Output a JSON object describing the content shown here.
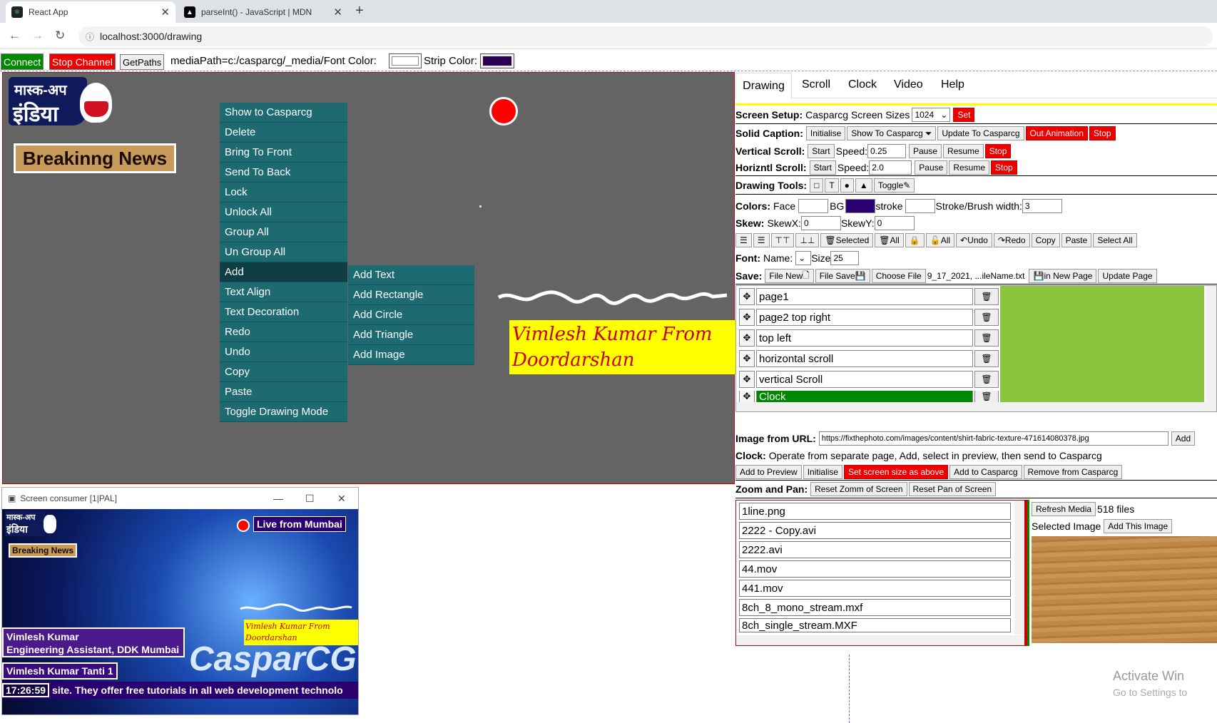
{
  "browser": {
    "tabs": [
      {
        "title": "React App",
        "icon": "react-icon"
      },
      {
        "title": "parseInt() - JavaScript | MDN",
        "icon": "mdn-icon"
      }
    ],
    "url": "localhost:3000/drawing"
  },
  "topbar": {
    "connect": "Connect",
    "stop_channel": "Stop Channel",
    "get_paths": "GetPaths",
    "media_path": "mediaPath=c:/casparcg/_media/Font Color:",
    "strip_color_label": "Strip Color:",
    "font_color": "#ffffff",
    "strip_color": "#2a0050"
  },
  "canvas": {
    "logo_line1": "मास्क-अप",
    "logo_line2": "इंडिया",
    "breaking": "Breakinng News",
    "caption": "Vimlesh Kumar From Doordarshan",
    "context_menu": [
      "Show to Casparcg",
      "Delete",
      "Bring To Front",
      "Send To Back",
      "Lock",
      "Unlock All",
      "Group All",
      "Un Group All",
      "Add",
      "Text Align",
      "Text Decoration",
      "Redo",
      "Undo",
      "Copy",
      "Paste",
      "Toggle Drawing Mode"
    ],
    "submenu": [
      "Add Text",
      "Add Rectangle",
      "Add Circle",
      "Add Triangle",
      "Add Image"
    ]
  },
  "panel": {
    "tabs": [
      "Drawing",
      "Scroll",
      "Clock",
      "Video",
      "Help"
    ],
    "screen_setup": {
      "label": "Screen Setup:",
      "text": "Casparcg Screen Sizes",
      "value": "1024",
      "set": "Set"
    },
    "solid_caption": {
      "label": "Solid Caption:",
      "initialise": "Initialise",
      "show": "Show To Casparcg",
      "update": "Update To Casparcg",
      "out": "Out Animation",
      "stop": "Stop"
    },
    "vscroll": {
      "label": "Vertical Scroll:",
      "start": "Start",
      "speed_label": "Speed:",
      "speed": "0.25",
      "pause": "Pause",
      "resume": "Resume",
      "stop": "Stop"
    },
    "hscroll": {
      "label": "Horizntl Scroll:",
      "start": "Start",
      "speed_label": "Speed:",
      "speed": "2.0",
      "pause": "Pause",
      "resume": "Resume",
      "stop": "Stop"
    },
    "drawing_tools": {
      "label": "Drawing Tools:",
      "t": "T",
      "toggle": "Toggle"
    },
    "colors": {
      "label": "Colors:",
      "face": "Face",
      "bg": "BG",
      "stroke": "stroke",
      "width_label": "Stroke/Brush width:",
      "width": "3",
      "bg_color": "#2a0070"
    },
    "skew": {
      "label": "Skew:",
      "x_label": "SkewX:",
      "x": "0",
      "y_label": "SkewY:",
      "y": "0"
    },
    "align_row": {
      "selected": "Selected",
      "all": "All",
      "lock_all": "All",
      "undo": "Undo",
      "redo": "Redo",
      "copy": "Copy",
      "paste": "Paste",
      "select_all": "Select All"
    },
    "font": {
      "label": "Font:",
      "name_label": "Name:",
      "size_label": "Size",
      "size": "25"
    },
    "save": {
      "label": "Save:",
      "file_new": "File New",
      "file_save": "File Save",
      "choose": "Choose File",
      "filename": "9_17_2021, ...ileName.txt",
      "new_page": "in New Page",
      "update_page": "Update Page"
    },
    "layers": [
      "page1",
      "page2 top right",
      "top left",
      "horizontal scroll",
      "vertical Scroll",
      "Clock"
    ],
    "image_url": {
      "label": "Image from URL:",
      "value": "https://fixthephoto.com/images/content/shirt-fabric-texture-471614080378.jpg",
      "add": "Add"
    },
    "clock": {
      "label": "Clock:",
      "text": "Operate from separate page, Add, select in preview, then send to Casparcg",
      "add_preview": "Add to Preview",
      "initialise": "Initialise",
      "set_size": "Set screen size as above",
      "add_caspar": "Add to Casparcg",
      "remove": "Remove from Casparcg"
    },
    "zoom": {
      "label": "Zoom and Pan:",
      "reset_zoom": "Reset Zomm of Screen",
      "reset_pan": "Reset Pan of Screen"
    },
    "media": [
      "1line.png",
      "2222 - Copy.avi",
      "2222.avi",
      "44.mov",
      "441.mov",
      "8ch_8_mono_stream.mxf",
      "8ch_single_stream.MXF"
    ],
    "refresh": "Refresh Media",
    "file_count": "518 files",
    "selected_image": "Selected Image",
    "add_image": "Add This Image"
  },
  "consumer": {
    "title": "Screen consumer [1|PAL]",
    "live": "Live from Mumbai",
    "breaking": "Breaking News",
    "name1": "Vimlesh Kumar",
    "name2": "Engineering Assistant, DDK Mumbai",
    "name3": "Vimlesh Kumar Tanti 1",
    "clock": "17:26:59",
    "ticker": "site. They offer free tutorials in all web development technolo",
    "caspar": "CasparCG",
    "caption": "Vimlesh Kumar From Doordarshan"
  },
  "watermark": {
    "line1": "Activate Win",
    "line2": "Go to Settings to"
  }
}
